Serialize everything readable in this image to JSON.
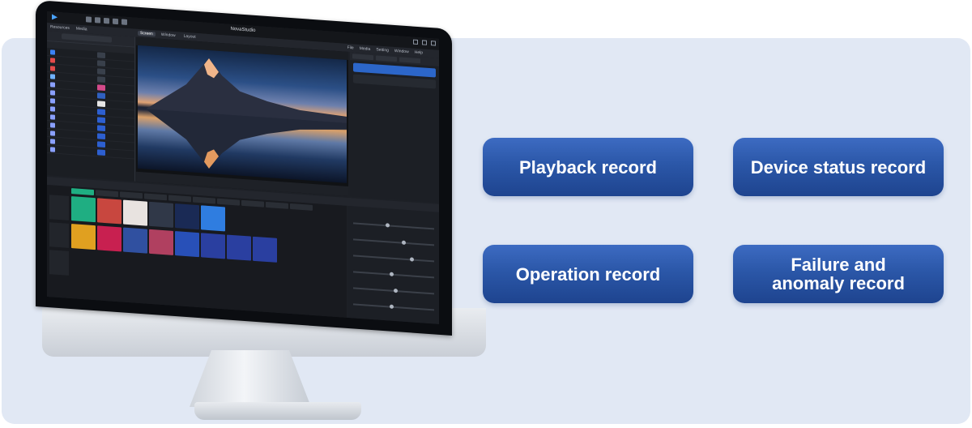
{
  "records": {
    "playback": "Playback record",
    "device_status": "Device status record",
    "operation": "Operation record",
    "failure_line1": "Failure and",
    "failure_line2": "anomaly record"
  },
  "app": {
    "window_title": "NovaStudio",
    "panel_tabs": [
      "Resources",
      "Media"
    ],
    "view_tabs": [
      "Screen",
      "Window",
      "Layout"
    ],
    "menus": [
      "File",
      "Media",
      "Setting",
      "Window",
      "Help"
    ]
  },
  "colors": {
    "accent": "#2b57a8",
    "scene_tab": "#1fae82",
    "page_bg": "#e1e8f4"
  }
}
